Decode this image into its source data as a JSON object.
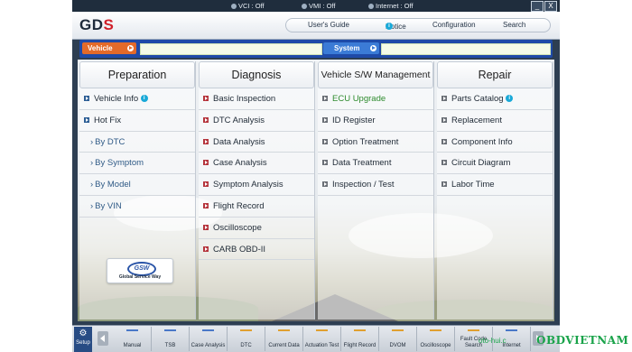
{
  "status": {
    "vci": "VCI : Off",
    "vmi": "VMI : Off",
    "internet": "Internet : Off"
  },
  "window": {
    "minimize": "_",
    "close": "X"
  },
  "header": {
    "logo_text": "GD",
    "logo_accent": "S",
    "nav": {
      "users_guide": "User's Guide",
      "notice": "Notice",
      "configuration": "Configuration",
      "search": "Search"
    }
  },
  "selectors": {
    "vehicle_label": "Vehicle",
    "vehicle_value": "",
    "system_label": "System",
    "system_value": ""
  },
  "columns": [
    {
      "title": "Preparation",
      "items": [
        {
          "label": "Vehicle Info",
          "info": "i"
        },
        {
          "label": "Hot Fix"
        },
        {
          "label": "By DTC"
        },
        {
          "label": "By Symptom"
        },
        {
          "label": "By Model"
        },
        {
          "label": "By VIN"
        }
      ]
    },
    {
      "title": "Diagnosis",
      "items": [
        {
          "label": "Basic Inspection"
        },
        {
          "label": "DTC Analysis"
        },
        {
          "label": "Data Analysis"
        },
        {
          "label": "Case Analysis"
        },
        {
          "label": "Symptom Analysis"
        },
        {
          "label": "Flight Record"
        },
        {
          "label": "Oscilloscope"
        },
        {
          "label": "CARB OBD-II"
        }
      ]
    },
    {
      "title": "Vehicle S/W Management",
      "items": [
        {
          "label": "ECU Upgrade"
        },
        {
          "label": "ID Register"
        },
        {
          "label": "Option Treatment"
        },
        {
          "label": "Data Treatment"
        },
        {
          "label": "Inspection / Test"
        }
      ]
    },
    {
      "title": "Repair",
      "items": [
        {
          "label": "Parts Catalog",
          "info": "i"
        },
        {
          "label": "Replacement"
        },
        {
          "label": "Component Info"
        },
        {
          "label": "Circuit Diagram"
        },
        {
          "label": "Labor Time"
        }
      ]
    }
  ],
  "gsw": {
    "logo": "GSW",
    "tagline": "Global Service Way"
  },
  "toolbar": {
    "setup": "Setup",
    "tools": [
      "Manual",
      "TSB",
      "Case Analysis",
      "DTC",
      "Current Data",
      "Actuation Test",
      "Flight Record",
      "DVOM",
      "Oscilloscope",
      "Fault Code Search",
      "Internet"
    ]
  },
  "watermark": {
    "text": "OBDVIETNAM",
    "small": "oto-hui.c"
  },
  "colors": {
    "bullet_blue": "#2d5e95",
    "bullet_red": "#b5343c",
    "bullet_gray": "#6a6f76",
    "ecu_upgrade_green": "#2e8b2e",
    "vehicle_orange": "#e36a2a",
    "system_blue": "#3b7bd6"
  }
}
